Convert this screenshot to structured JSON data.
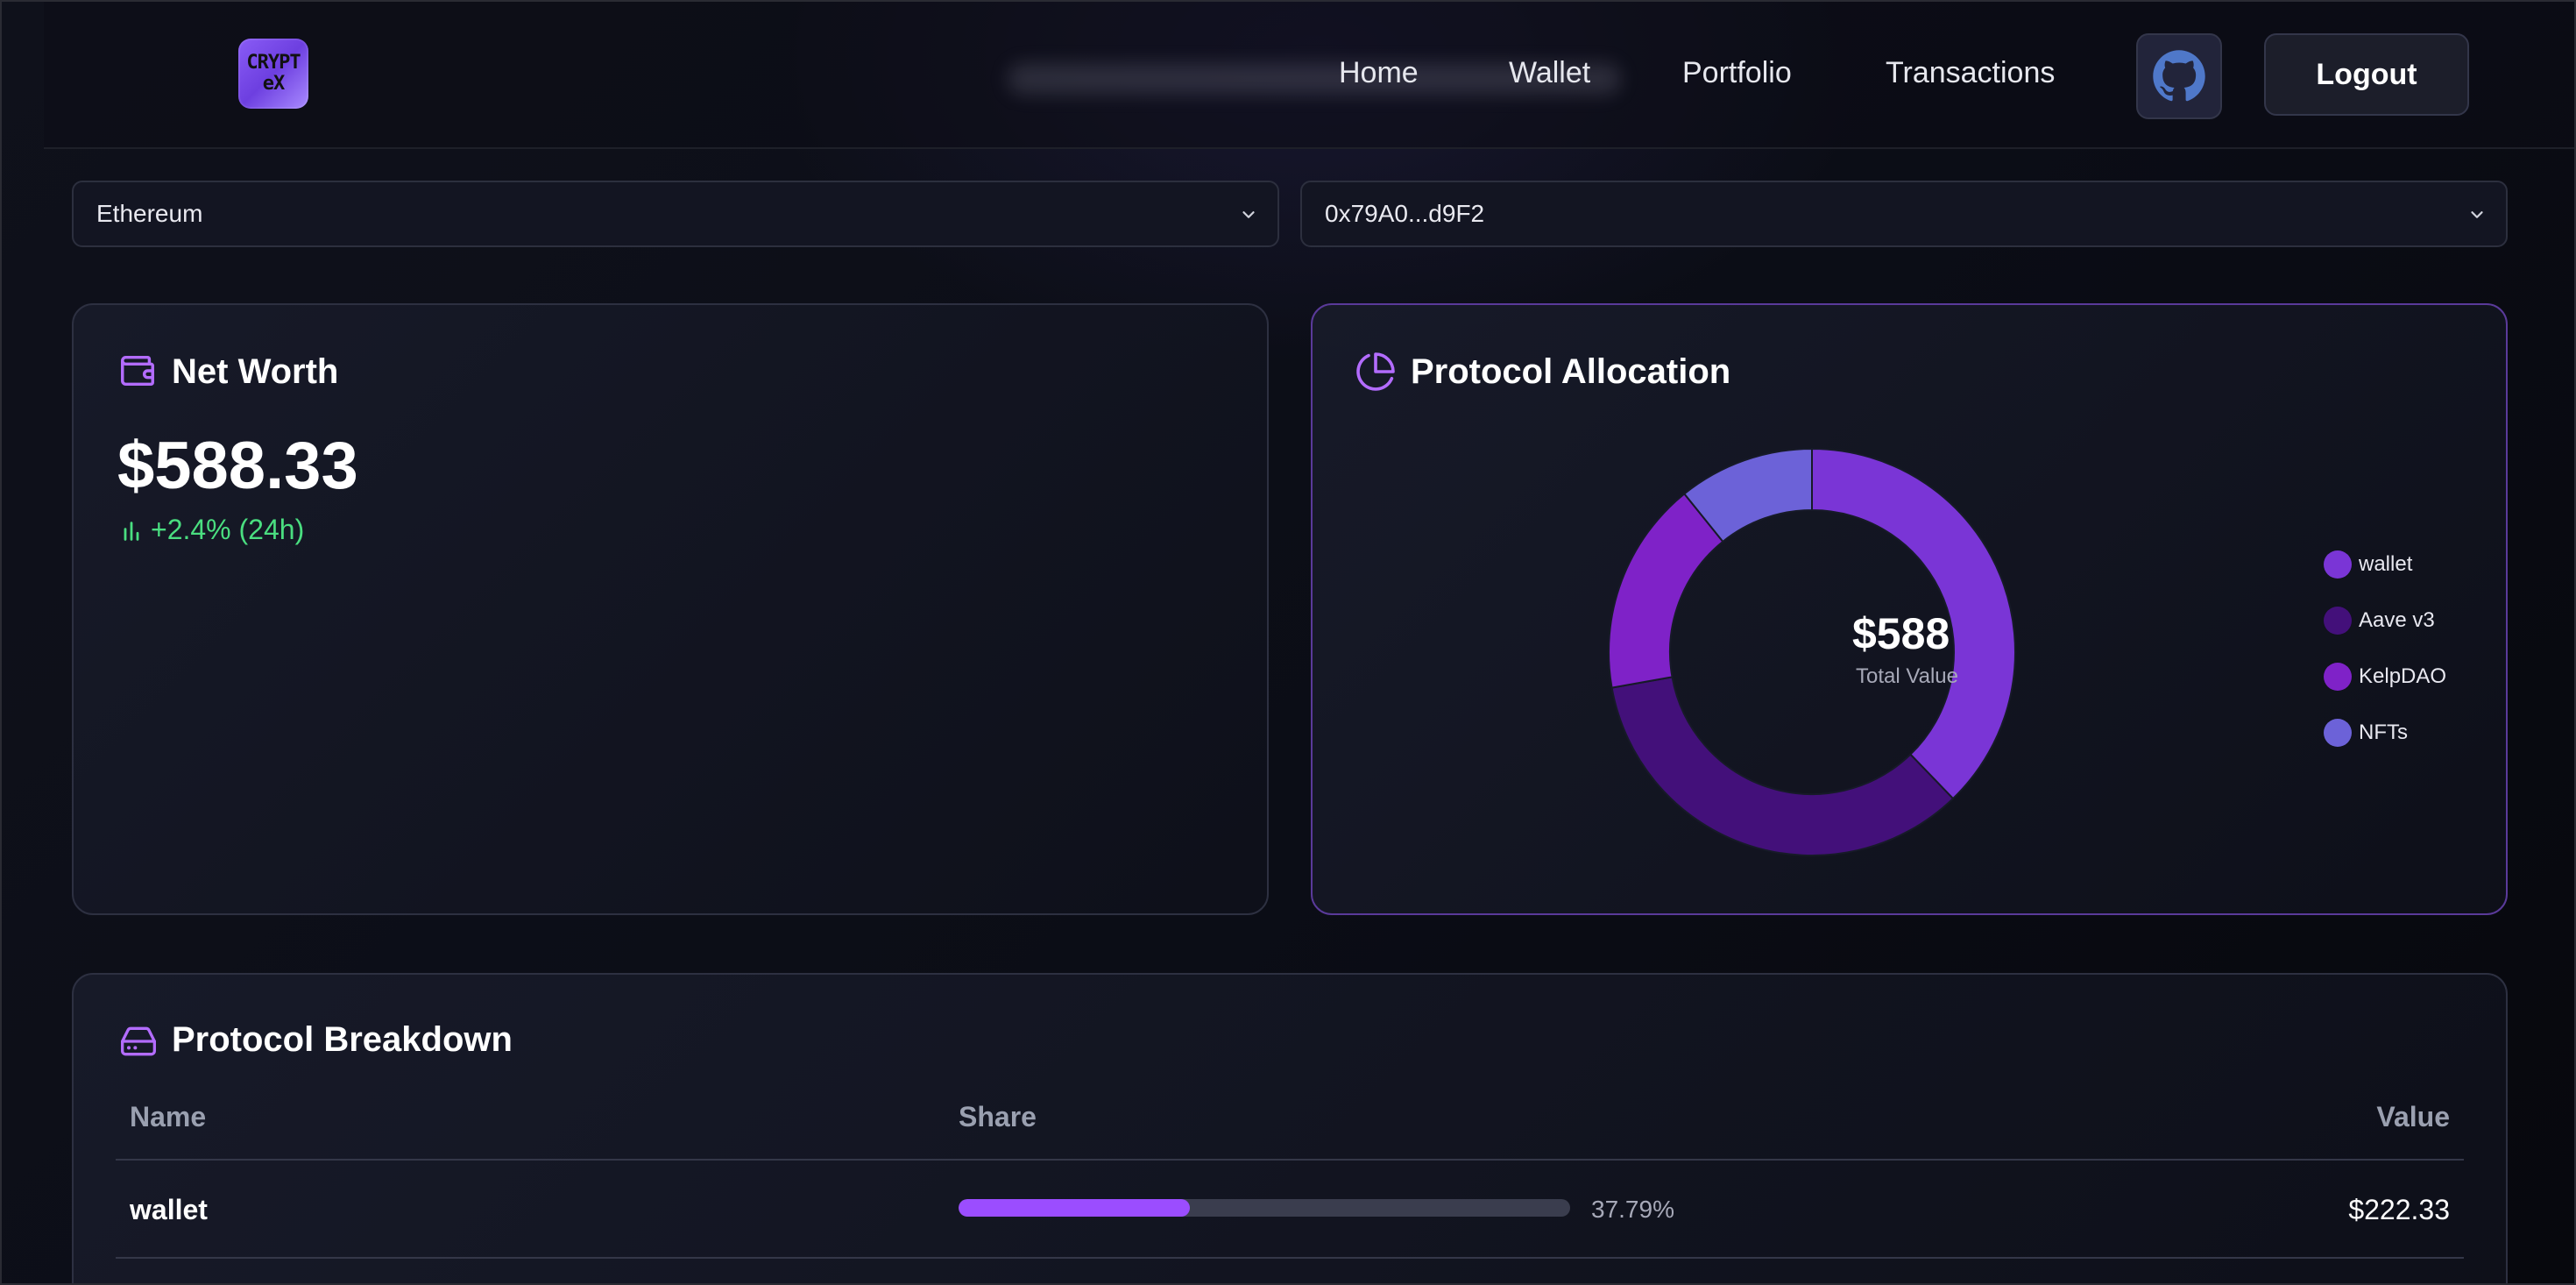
{
  "header": {
    "logo_text_line1": "CRYPT",
    "logo_text_line2": "eX",
    "nav": [
      "Home",
      "Wallet",
      "Portfolio",
      "Transactions"
    ],
    "github_icon": "github-icon",
    "logout_label": "Logout"
  },
  "selectors": {
    "network": "Ethereum",
    "address": "0x79A0...d9F2"
  },
  "net_worth": {
    "title": "Net Worth",
    "icon": "wallet-icon",
    "value": "$588.33",
    "change": "+2.4% (24h)",
    "change_color": "#4ade80"
  },
  "allocation": {
    "title": "Protocol Allocation",
    "icon": "pie-chart-icon",
    "center_value": "$588",
    "center_label": "Total Value",
    "legend": [
      "wallet",
      "Aave v3",
      "KelpDAO",
      "NFTs"
    ]
  },
  "chart_data": {
    "type": "pie",
    "categories": [
      "wallet",
      "Aave v3",
      "KelpDAO",
      "NFTs"
    ],
    "values": [
      37.79,
      34.4,
      17.0,
      10.8
    ],
    "colors": [
      "#7a35d6",
      "#43107a",
      "#7f22c8",
      "#6c62d8"
    ],
    "center_value": "$588",
    "center_label": "Total Value",
    "legend_position": "right"
  },
  "breakdown": {
    "title": "Protocol Breakdown",
    "icon": "hard-drive-icon",
    "columns": [
      "Name",
      "Share",
      "Value"
    ],
    "rows": [
      {
        "name": "wallet",
        "share_pct": "37.79%",
        "share_fraction": 0.3779,
        "value": "$222.33"
      }
    ]
  },
  "colors": {
    "accent": "#9b4dff",
    "positive": "#4ade80",
    "background": "#0b0c14"
  }
}
